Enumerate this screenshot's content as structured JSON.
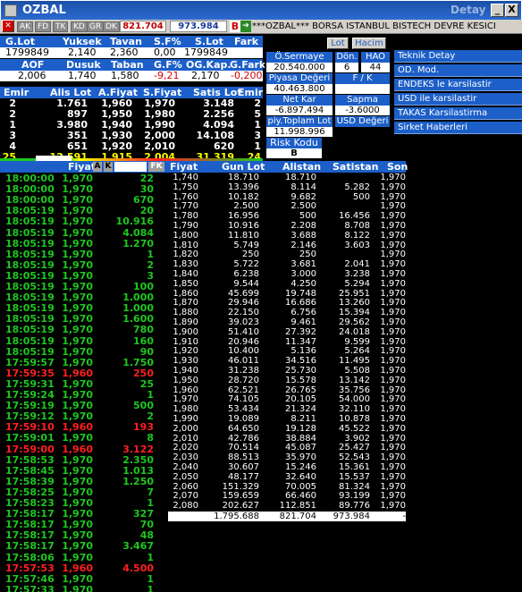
{
  "window": {
    "title": "OZBAL",
    "detay": "Detay",
    "btn_min": "_",
    "btn_max": "□",
    "btn_close": "X"
  },
  "toolbar": {
    "tabs": [
      "AK",
      "FD",
      "TK",
      "KD",
      "GR",
      "DK"
    ],
    "value1": "821.704",
    "value2": "973.984",
    "b_label": "B",
    "ticker": "***OZBAL*** BORSA ISTANBUL BISTECH DEVRE KESİCİ"
  },
  "summary": {
    "h1": [
      "G.Lot",
      "Yuksek",
      "Tavan",
      "S.F%",
      "S.Lot",
      "Fark"
    ],
    "v1": [
      "1799849",
      "2,140",
      "2,360",
      "0,00",
      "1799849",
      ""
    ],
    "h2": [
      "AOF",
      "Dusuk",
      "Taban",
      "G.F%",
      "OG.Kap.",
      "G.Fark"
    ],
    "v2": [
      "2,006",
      "1,740",
      "1,580",
      "-9,21",
      "2,170",
      "-0,200"
    ]
  },
  "depth": {
    "headers": [
      "Emir",
      "Alis Lot",
      "A.Fiyat",
      "S.Fiyat",
      "Satis Lot",
      "Emir"
    ],
    "rows": [
      [
        "2",
        "1.761",
        "1,960",
        "1,970",
        "3.148",
        "2"
      ],
      [
        "2",
        "897",
        "1,950",
        "1,980",
        "2.256",
        "5"
      ],
      [
        "1",
        "3.980",
        "1,940",
        "1,990",
        "4.094",
        "1"
      ],
      [
        "3",
        "351",
        "1,930",
        "2,000",
        "14.108",
        "3"
      ],
      [
        "4",
        "651",
        "1,920",
        "2,010",
        "620",
        "1"
      ]
    ],
    "totals": [
      "25",
      "12.591",
      "1,915",
      "2,004",
      "31.319",
      "24"
    ]
  },
  "info_panel": {
    "btn_lot": "Lot",
    "btn_hacim": "Hacim",
    "o_sermaye_label": "Ö.Sermaye",
    "o_sermaye_value": "20.540.000",
    "don_label": "Dön.",
    "don_value": "6",
    "hao_label": "HAO",
    "hao_value": "44",
    "piyasa_label": "Piyasa Değeri",
    "piyasa_value": "40.463.800",
    "fk_label": "F / K",
    "fk_value": "",
    "netkar_label": "Net Kar",
    "netkar_value": "-6.897.494",
    "sapma_label": "Sapma",
    "sapma_value": "-3.6000",
    "piy_label": "piy.Toplam Lot",
    "piy_value": "11.998.996",
    "usd_label": "USD Değeri",
    "risk_label": "Risk Kodu",
    "risk_value": "B"
  },
  "right_menu": [
    "Teknik Detay",
    "OD. Mod.",
    "ENDEKS le karsilastir",
    "USD ile karsilastir",
    "TAKAS Karsilastirma",
    "Sirket Haberleri"
  ],
  "trades": {
    "headers": {
      "fiyat": "Fiyat",
      "btn_a": "A",
      "btn_k": "K",
      "btn_fk": "FK"
    },
    "rows": [
      [
        "18:00:00",
        "1,970",
        "22",
        "g"
      ],
      [
        "18:00:00",
        "1,970",
        "30",
        "g"
      ],
      [
        "18:00:00",
        "1,970",
        "670",
        "g"
      ],
      [
        "18:05:19",
        "1,970",
        "20",
        "g"
      ],
      [
        "18:05:19",
        "1,970",
        "10.916",
        "g"
      ],
      [
        "18:05:19",
        "1,970",
        "4.084",
        "g"
      ],
      [
        "18:05:19",
        "1,970",
        "1.270",
        "g"
      ],
      [
        "18:05:19",
        "1,970",
        "1",
        "g"
      ],
      [
        "18:05:19",
        "1,970",
        "2",
        "g"
      ],
      [
        "18:05:19",
        "1,970",
        "3",
        "g"
      ],
      [
        "18:05:19",
        "1,970",
        "100",
        "g"
      ],
      [
        "18:05:19",
        "1,970",
        "1.000",
        "g"
      ],
      [
        "18:05:19",
        "1,970",
        "1.000",
        "g"
      ],
      [
        "18:05:19",
        "1,970",
        "1.600",
        "g"
      ],
      [
        "18:05:19",
        "1,970",
        "780",
        "g"
      ],
      [
        "18:05:19",
        "1,970",
        "160",
        "g"
      ],
      [
        "18:05:19",
        "1,970",
        "90",
        "g"
      ],
      [
        "17:59:57",
        "1,970",
        "1.750",
        "g"
      ],
      [
        "17:59:35",
        "1,960",
        "250",
        "r"
      ],
      [
        "17:59:31",
        "1,970",
        "25",
        "g"
      ],
      [
        "17:59:24",
        "1,970",
        "1",
        "g"
      ],
      [
        "17:59:19",
        "1,970",
        "500",
        "g"
      ],
      [
        "17:59:12",
        "1,970",
        "2",
        "g"
      ],
      [
        "17:59:10",
        "1,960",
        "193",
        "r"
      ],
      [
        "17:59:01",
        "1,970",
        "8",
        "g"
      ],
      [
        "17:59:00",
        "1,960",
        "3.122",
        "r"
      ],
      [
        "17:58:53",
        "1,970",
        "2.350",
        "g"
      ],
      [
        "17:58:45",
        "1,970",
        "1.013",
        "g"
      ],
      [
        "17:58:39",
        "1,970",
        "1.250",
        "g"
      ],
      [
        "17:58:25",
        "1,970",
        "7",
        "g"
      ],
      [
        "17:58:23",
        "1,970",
        "1",
        "g"
      ],
      [
        "17:58:17",
        "1,970",
        "327",
        "g"
      ],
      [
        "17:58:17",
        "1,970",
        "70",
        "g"
      ],
      [
        "17:58:17",
        "1,970",
        "48",
        "g"
      ],
      [
        "17:58:17",
        "1,970",
        "3.467",
        "g"
      ],
      [
        "17:58:06",
        "1,970",
        "1",
        "g"
      ],
      [
        "17:57:53",
        "1,960",
        "4.500",
        "r"
      ],
      [
        "17:57:46",
        "1,970",
        "1",
        "g"
      ],
      [
        "17:57:33",
        "1,970",
        "1",
        "g"
      ]
    ]
  },
  "dist": {
    "headers": [
      "Fiyat",
      "Gun Lot",
      "Alistan",
      "Satistan",
      "Son"
    ],
    "rows": [
      [
        "1,740",
        "18.710",
        "18.710",
        "",
        "1,970"
      ],
      [
        "1,750",
        "13.396",
        "8.114",
        "5.282",
        "1,970"
      ],
      [
        "1,760",
        "10.182",
        "9.682",
        "500",
        "1,970"
      ],
      [
        "1,770",
        "2.500",
        "2.500",
        "",
        "1,970"
      ],
      [
        "1,780",
        "16.956",
        "500",
        "16.456",
        "1,970"
      ],
      [
        "1,790",
        "10.916",
        "2.208",
        "8.708",
        "1,970"
      ],
      [
        "1,800",
        "11.810",
        "3.688",
        "8.122",
        "1,970"
      ],
      [
        "1,810",
        "5.749",
        "2.146",
        "3.603",
        "1,970"
      ],
      [
        "1,820",
        "250",
        "250",
        "",
        "1,970"
      ],
      [
        "1,830",
        "5.722",
        "3.681",
        "2.041",
        "1,970"
      ],
      [
        "1,840",
        "6.238",
        "3.000",
        "3.238",
        "1,970"
      ],
      [
        "1,850",
        "9.544",
        "4.250",
        "5.294",
        "1,970"
      ],
      [
        "1,860",
        "45.699",
        "19.748",
        "25.951",
        "1,970"
      ],
      [
        "1,870",
        "29.946",
        "16.686",
        "13.260",
        "1,970"
      ],
      [
        "1,880",
        "22.150",
        "6.756",
        "15.394",
        "1,970"
      ],
      [
        "1,890",
        "39.023",
        "9.461",
        "29.562",
        "1,970"
      ],
      [
        "1,900",
        "51.410",
        "27.392",
        "24.018",
        "1,970"
      ],
      [
        "1,910",
        "20.946",
        "11.347",
        "9.599",
        "1,970"
      ],
      [
        "1,920",
        "10.400",
        "5.136",
        "5.264",
        "1,970"
      ],
      [
        "1,930",
        "46.011",
        "34.516",
        "11.495",
        "1,970"
      ],
      [
        "1,940",
        "31.238",
        "25.730",
        "5.508",
        "1,970"
      ],
      [
        "1,950",
        "28.720",
        "15.578",
        "13.142",
        "1,970"
      ],
      [
        "1,960",
        "62.521",
        "26.765",
        "35.756",
        "1,970"
      ],
      [
        "1,970",
        "74.105",
        "20.105",
        "54.000",
        "1,970"
      ],
      [
        "1,980",
        "53.434",
        "21.324",
        "32.110",
        "1,970"
      ],
      [
        "1,990",
        "19.089",
        "8.211",
        "10.878",
        "1,970"
      ],
      [
        "2,000",
        "64.650",
        "19.128",
        "45.522",
        "1,970"
      ],
      [
        "2,010",
        "42.786",
        "38.884",
        "3.902",
        "1,970"
      ],
      [
        "2,020",
        "70.514",
        "45.087",
        "25.427",
        "1,970"
      ],
      [
        "2,030",
        "88.513",
        "35.970",
        "52.543",
        "1,970"
      ],
      [
        "2,040",
        "30.607",
        "15.246",
        "15.361",
        "1,970"
      ],
      [
        "2,050",
        "48.177",
        "32.640",
        "15.537",
        "1,970"
      ],
      [
        "2,060",
        "151.329",
        "70.005",
        "81.324",
        "1,970"
      ],
      [
        "2,070",
        "159.659",
        "66.460",
        "93.199",
        "1,970"
      ],
      [
        "2,080",
        "202.627",
        "112.851",
        "89.776",
        "1,970"
      ]
    ],
    "totals": [
      "",
      "1.795.688",
      "821.704",
      "973.984",
      "-"
    ]
  },
  "colors": {
    "header_blue": "#1c5fc8",
    "green": "#1ec81e",
    "red": "#ff2020",
    "yellow": "#ffff00"
  }
}
